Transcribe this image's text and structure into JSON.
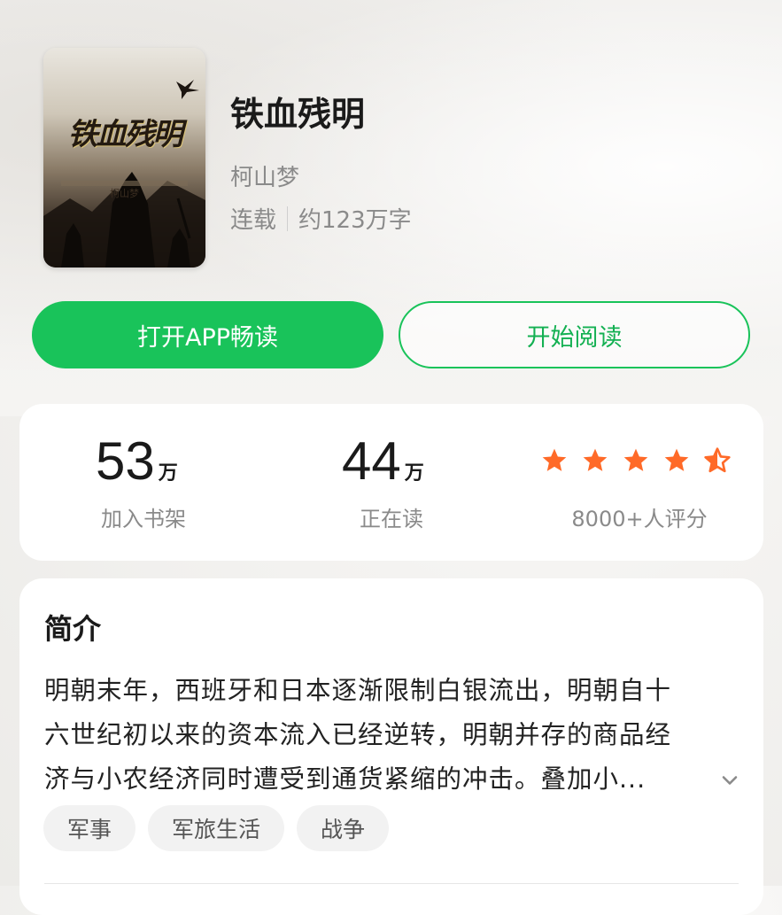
{
  "book": {
    "title": "铁血残明",
    "author": "柯山梦",
    "status": "连载",
    "word_count": "约123万字",
    "cover": {
      "title_text": "铁血残明",
      "author_text": "柯山梦"
    }
  },
  "actions": {
    "open_app_label": "打开APP畅读",
    "start_reading_label": "开始阅读"
  },
  "stats": {
    "shelf": {
      "value": "53",
      "unit": "万",
      "label": "加入书架"
    },
    "reading": {
      "value": "44",
      "unit": "万",
      "label": "正在读"
    },
    "rating": {
      "stars": 4.5,
      "max_stars": 5,
      "label": "8000+人评分",
      "star_color": "#ff6a28"
    }
  },
  "intro": {
    "heading": "简介",
    "lines": [
      "明朝末年，西班牙和日本逐渐限制白银流出，明朝自十",
      "六世纪初以来的资本流入已经逆转，明朝并存的商品经",
      "济与小农经济同时遭受到通货紧缩的冲击。叠加小..."
    ],
    "expand_icon": "chevron-down-icon",
    "tags": [
      "军事",
      "军旅生活",
      "战争"
    ]
  },
  "colors": {
    "accent": "#19c35a",
    "star": "#ff6a28"
  }
}
